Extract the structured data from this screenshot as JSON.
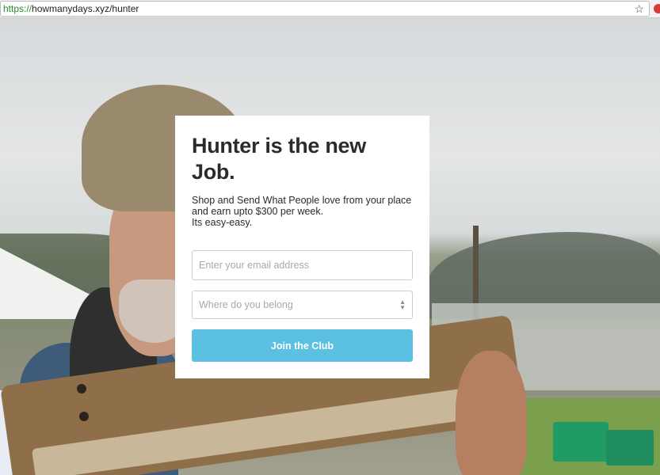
{
  "browser": {
    "url_scheme": "https://",
    "url_rest": "howmanydays.xyz/hunter",
    "bookmark_icon": "star-icon"
  },
  "signup": {
    "title": "Hunter is the new Job.",
    "lead_line1": "Shop and Send What People love from your place and earn upto $300 per week.",
    "lead_line2": "Its easy-easy.",
    "email_placeholder": "Enter your email address",
    "belong_placeholder": "Where do you belong",
    "join_label": "Join the Club"
  },
  "colors": {
    "button": "#5bc0e2",
    "url_scheme": "#2a8a2a"
  }
}
